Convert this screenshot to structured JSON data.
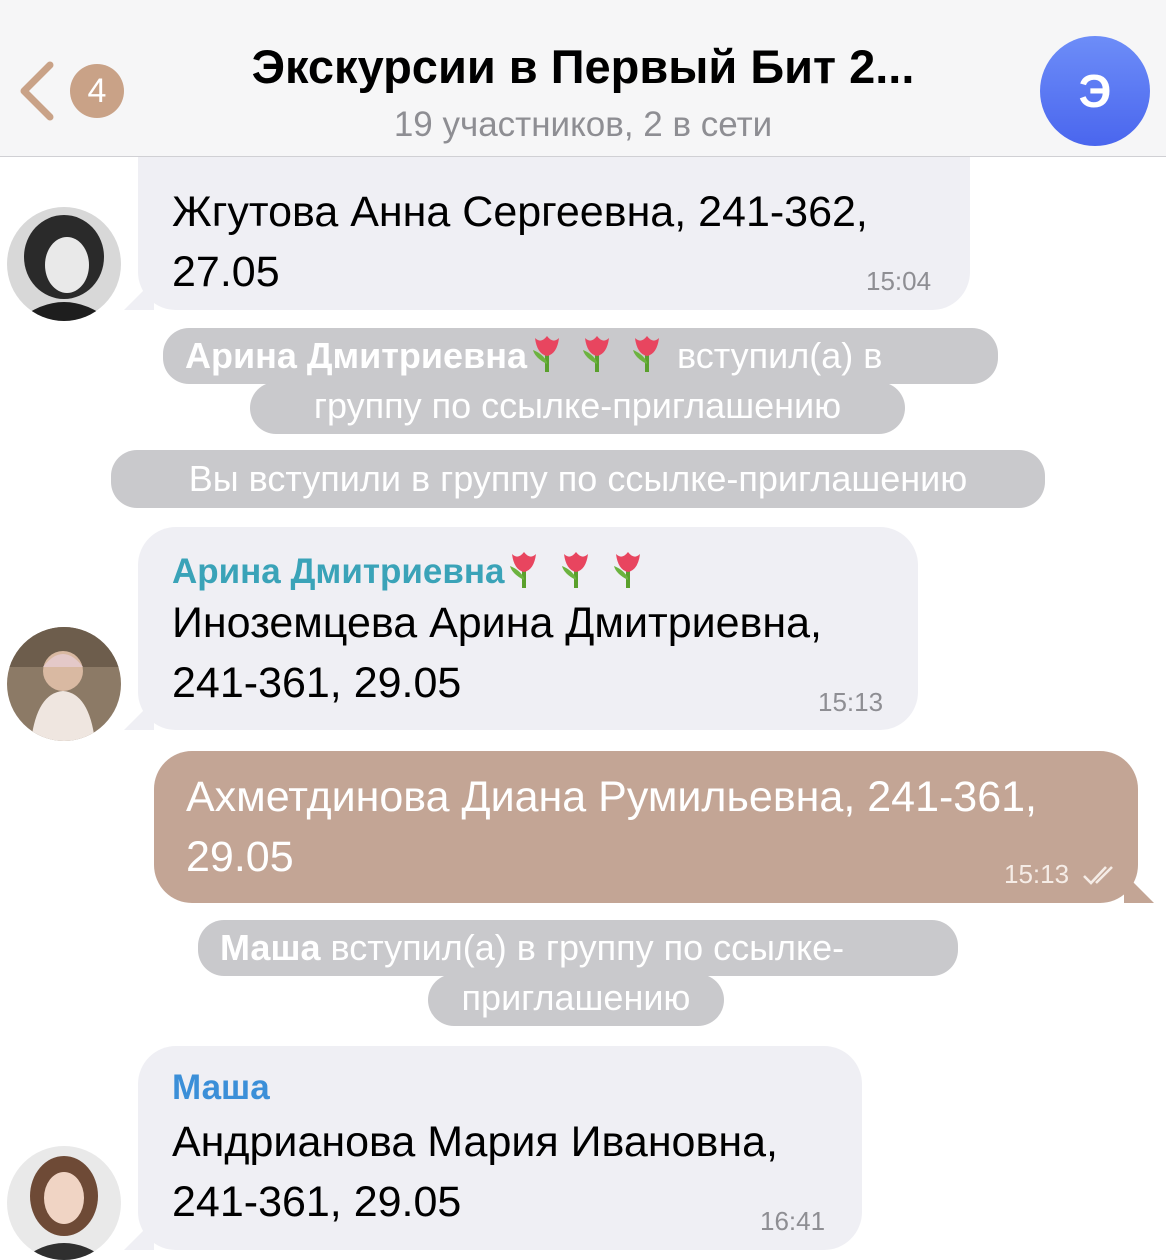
{
  "header": {
    "back_badge": "4",
    "title": "Экскурсии в Первый Бит 2...",
    "subtitle": "19 участников, 2 в сети",
    "avatar_letter": "Э"
  },
  "messages": [
    {
      "text_line1": "Жгутова Анна Сергеевна, 241-362,",
      "text_line2": "27.05",
      "time": "15:04"
    },
    {
      "sender": "Арина Дмитриевна",
      "text_line1": "Иноземцева Арина Дмитриевна,",
      "text_line2": "241-361, 29.05",
      "time": "15:13"
    },
    {
      "text_line1": "Ахметдинова Диана Румильевна, 241-361,",
      "text_line2": "29.05",
      "time": "15:13"
    },
    {
      "sender": "Маша",
      "text_line1": "Андрианова Мария Ивановна,",
      "text_line2": "241-361, 29.05",
      "time": "16:41"
    }
  ],
  "service": [
    {
      "name": "Арина Дмитриевна",
      "line1_rest": "вступил(а) в",
      "line2": "группу по ссылке-приглашению"
    },
    {
      "line1": "Вы вступили в группу по ссылке-приглашению"
    },
    {
      "name": "Маша",
      "line1_rest": "вступил(а) в группу по ссылке-",
      "line2": "приглашению"
    }
  ],
  "colors": {
    "accent_sender_1": "#3aa3b8",
    "accent_sender_2": "#3b8fd8",
    "outgoing_bubble": "#c3a595",
    "badge": "#c9a287"
  },
  "icons": [
    "back-chevron-icon",
    "tulip-icon",
    "double-check-icon"
  ]
}
